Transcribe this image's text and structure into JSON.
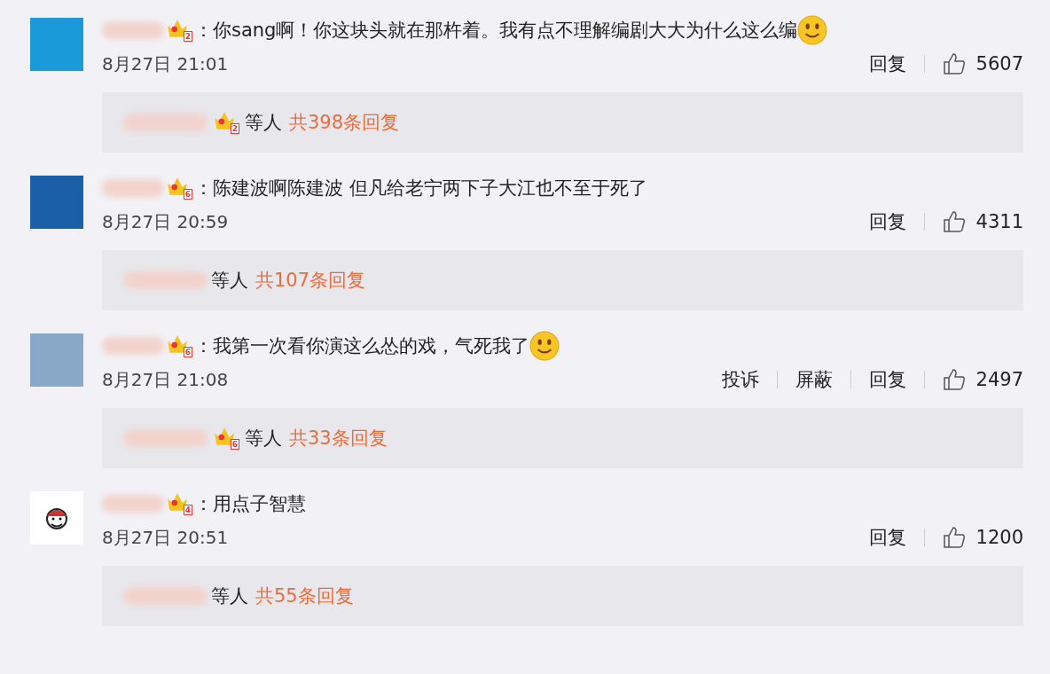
{
  "comments": [
    {
      "avatar": {
        "kind": "photo"
      },
      "badge": "2",
      "text": "：你sang啊！你这块头就在那杵着。我有点不理解编剧大大为什么这么编",
      "emoji": true,
      "time": "8月27日 21:01",
      "actions": [
        "回复"
      ],
      "likes": "5607",
      "reply_badge": "2",
      "reply_who": "等人",
      "reply_count": "共398条回复"
    },
    {
      "avatar": {
        "kind": "photo"
      },
      "badge": "6",
      "text": "：陈建波啊陈建波 但凡给老宁两下子大江也不至于死了",
      "emoji": false,
      "time": "8月27日 20:59",
      "actions": [
        "回复"
      ],
      "likes": "4311",
      "reply_who": "等人",
      "reply_count": "共107条回复"
    },
    {
      "avatar": {
        "kind": "photo"
      },
      "badge": "6",
      "text": "：我第一次看你演这么怂的戏，气死我了",
      "emoji": true,
      "time": "8月27日 21:08",
      "actions": [
        "投诉",
        "屏蔽",
        "回复"
      ],
      "likes": "2497",
      "reply_badge": "6",
      "reply_who": "等人",
      "reply_count": "共33条回复"
    },
    {
      "avatar": {
        "kind": "cartoon"
      },
      "badge": "4",
      "text": "：用点子智慧",
      "emoji": false,
      "time": "8月27日 20:51",
      "actions": [
        "回复"
      ],
      "likes": "1200",
      "reply_who": "等人",
      "reply_count": "共55条回复"
    }
  ]
}
